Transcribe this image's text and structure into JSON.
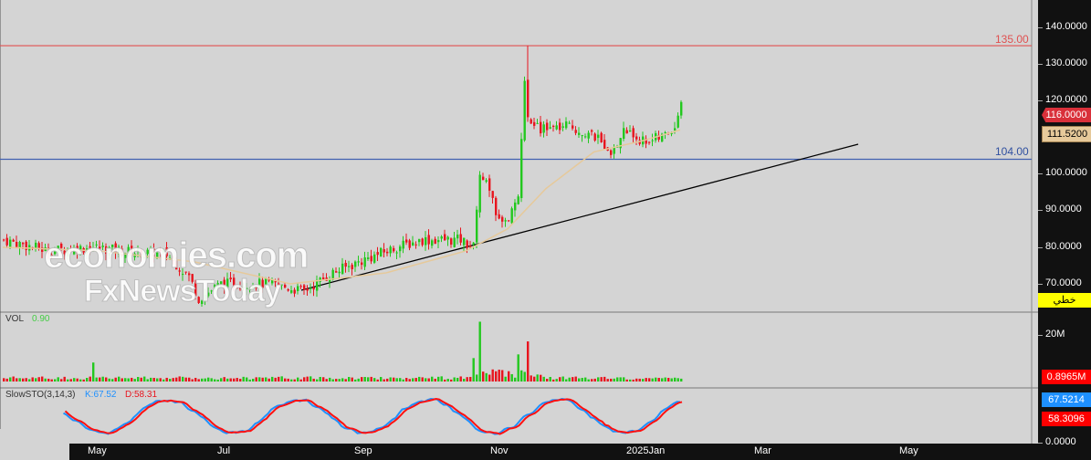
{
  "chart_data": {
    "type": "candlestick",
    "price_axis": {
      "ticks": [
        "140.0000",
        "130.0000",
        "120.0000",
        "100.0000",
        "90.0000",
        "80.0000",
        "70.0000"
      ],
      "range": [
        68,
        143
      ]
    },
    "x_ticks": [
      "May",
      "Jul",
      "Sep",
      "Nov",
      "2025Jan",
      "Mar",
      "May"
    ],
    "price_keypoints": [
      [
        0,
        82
      ],
      [
        14,
        79
      ],
      [
        28,
        80
      ],
      [
        37,
        79
      ],
      [
        51,
        78
      ],
      [
        58,
        72
      ],
      [
        61,
        66
      ],
      [
        68,
        70
      ],
      [
        83,
        70
      ],
      [
        94,
        68
      ],
      [
        103,
        73
      ],
      [
        114,
        77
      ],
      [
        123,
        80
      ],
      [
        131,
        82
      ],
      [
        143,
        82
      ],
      [
        147,
        80
      ],
      [
        149,
        100
      ],
      [
        151,
        97
      ],
      [
        155,
        87
      ],
      [
        158,
        88
      ],
      [
        161,
        95
      ],
      [
        163,
        124
      ],
      [
        164,
        116
      ],
      [
        168,
        112
      ],
      [
        177,
        113
      ],
      [
        185,
        110
      ],
      [
        191,
        106
      ],
      [
        194,
        112
      ],
      [
        200,
        109
      ],
      [
        206,
        110
      ],
      [
        210,
        113
      ],
      [
        212,
        120
      ]
    ],
    "ma_keypoints": [
      [
        0,
        80
      ],
      [
        30,
        79
      ],
      [
        60,
        76
      ],
      [
        90,
        70
      ],
      [
        120,
        73
      ],
      [
        145,
        79
      ],
      [
        158,
        85
      ],
      [
        170,
        96
      ],
      [
        185,
        106
      ],
      [
        200,
        109
      ],
      [
        212,
        112
      ]
    ],
    "levels": [
      {
        "value": 135,
        "label": "135.00",
        "color": "#e05050"
      },
      {
        "value": 104,
        "label": "104.00",
        "color": "#4060b0"
      }
    ],
    "last_price": "116.0000",
    "ma_value": "111.5200",
    "mode_label": "خطي",
    "volume": {
      "title": "VOL",
      "value": "0.90",
      "tick": "20M",
      "last": "0.8965M",
      "spikes": [
        [
          28,
          8
        ],
        [
          147,
          9
        ],
        [
          149,
          22
        ],
        [
          161,
          8
        ],
        [
          164,
          15
        ]
      ]
    },
    "stochastic": {
      "title": "SlowSTO(3,14,3)",
      "k_label": "K:67.52",
      "d_label": "D:58.31",
      "k_last": "67.5214",
      "d_last": "58.3096",
      "tick": "0.0000"
    },
    "colors": {
      "up": "#22c81e",
      "down": "#e8141e",
      "k": "#1e90ff",
      "d": "#ff1010",
      "ma": "#e6c99a"
    }
  },
  "watermark": {
    "line1": "economies.com",
    "line2": "FxNewsToday"
  }
}
